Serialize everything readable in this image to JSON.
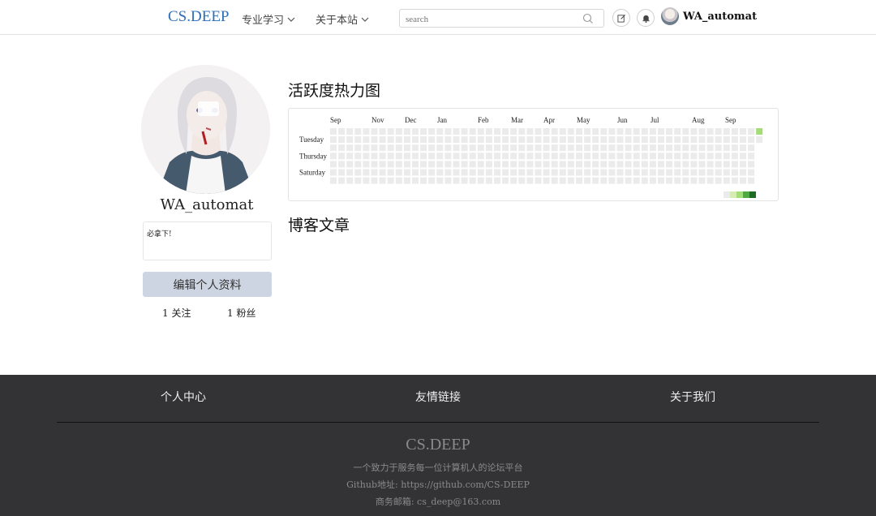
{
  "header": {
    "brand": "CS.DEEP",
    "nav": [
      {
        "label": "专业学习"
      },
      {
        "label": "关于本站"
      }
    ],
    "search": {
      "placeholder": "search"
    },
    "user": {
      "name": "WA_automat"
    }
  },
  "profile": {
    "name": "WA_automat",
    "bio": "必拿下!",
    "edit_label": "编辑个人资料",
    "following": "1 关注",
    "followers": "1 粉丝"
  },
  "main": {
    "heatmap_title": "活跃度热力图",
    "heatmap": {
      "months": [
        "Sep",
        "Nov",
        "Dec",
        "Jan",
        "Feb",
        "Mar",
        "Apr",
        "May",
        "Jun",
        "Jul",
        "Aug",
        "Sep"
      ],
      "day_labels": [
        "Tuesday",
        "Thursday",
        "Saturday"
      ],
      "active_cell_color": "#a4dd78",
      "empty_cell_color": "#ebebeb",
      "legend_colors": [
        "#ebebeb",
        "#d6ecb5",
        "#a4dd78",
        "#52a843",
        "#1e6b24"
      ]
    },
    "blog_title": "博客文章"
  },
  "footer": {
    "links": [
      "个人中心",
      "友情链接",
      "关于我们"
    ],
    "brand": "CS.DEEP",
    "tagline": "一个致力于服务每一位计算机人的论坛平台",
    "github": "Github地址: https://github.com/CS-DEEP",
    "email": "商务邮箱: cs_deep@163.com"
  },
  "colors": {
    "brand": "#2e6fb7",
    "edit_button": "#cdd5e3",
    "footer_bg": "#333335"
  }
}
